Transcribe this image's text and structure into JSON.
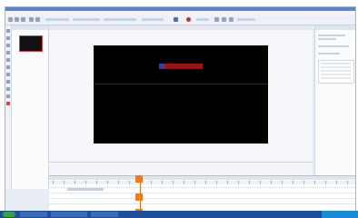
{
  "app": {
    "title": ""
  },
  "menu": [],
  "panels": {
    "slides_header": "",
    "canvas_header": "",
    "right_header": "",
    "timeline_header": ""
  },
  "banner": {
    "text": ""
  },
  "info": {
    "left": "",
    "right": ""
  },
  "taskbar": {
    "clock": ""
  },
  "icons": [
    "new-icon",
    "open-icon",
    "save-icon",
    "undo-icon",
    "redo-icon",
    "cut-icon",
    "copy-icon",
    "paste-icon",
    "play-icon",
    "record-icon"
  ]
}
